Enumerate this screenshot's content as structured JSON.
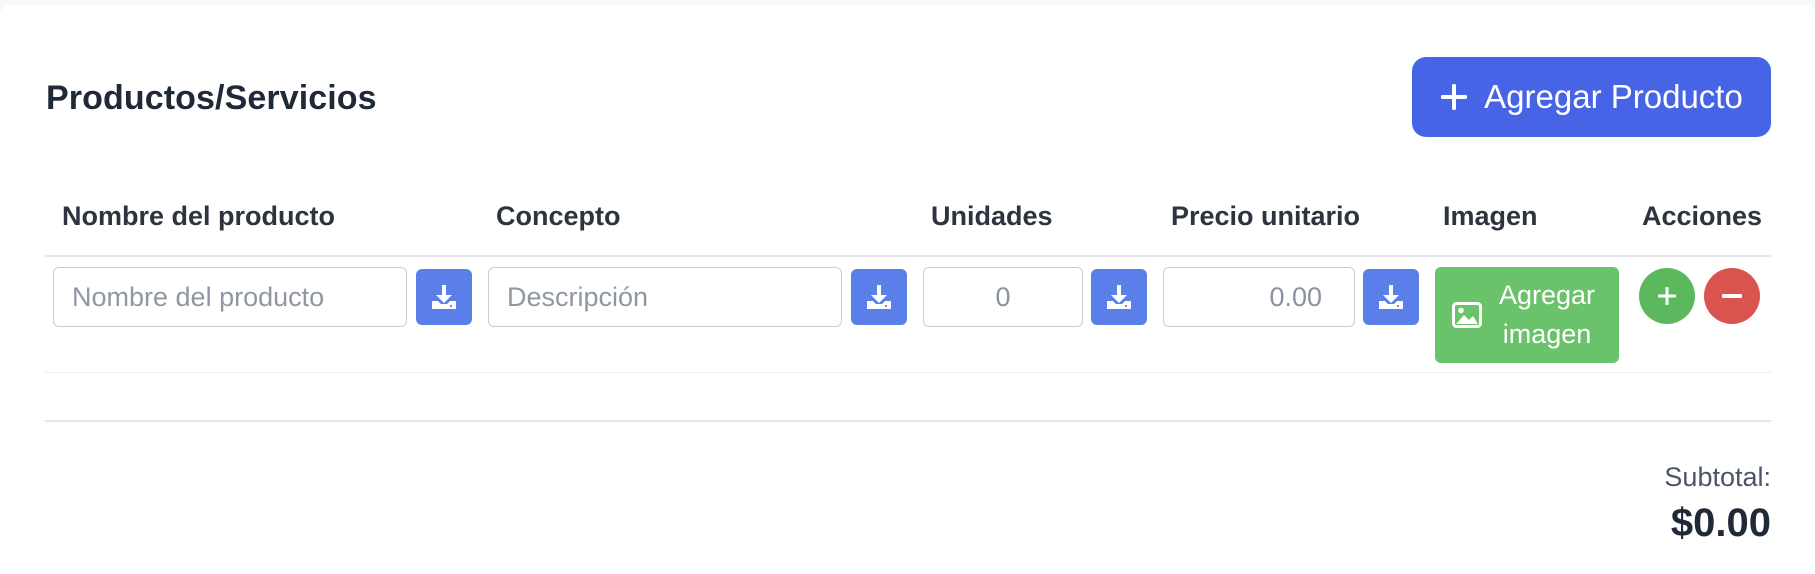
{
  "section": {
    "title": "Productos/Servicios",
    "add_button_label": "Agregar Producto"
  },
  "table": {
    "columns": [
      "Nombre del producto",
      "Concepto",
      "Unidades",
      "Precio unitario",
      "Imagen",
      "Acciones"
    ],
    "rows": [
      {
        "name_placeholder": "Nombre del producto",
        "name_value": "",
        "concept_placeholder": "Descripción",
        "concept_value": "",
        "units_value": "0",
        "unit_price_value": "0.00",
        "image_button_label": "Agregar imagen"
      }
    ]
  },
  "summary": {
    "subtotal_label": "Subtotal:",
    "subtotal_value": "$0.00"
  },
  "icons": {
    "add": "plus-icon",
    "download": "download-icon",
    "image": "image-icon",
    "add_row": "plus-icon",
    "remove_row": "minus-icon"
  },
  "colors": {
    "primary": "#4763e6",
    "download_button": "#5b7fe9",
    "success": "#6ac26a",
    "add_row": "#5cb85c",
    "remove_row": "#d9534f",
    "text": "#1f2937"
  }
}
